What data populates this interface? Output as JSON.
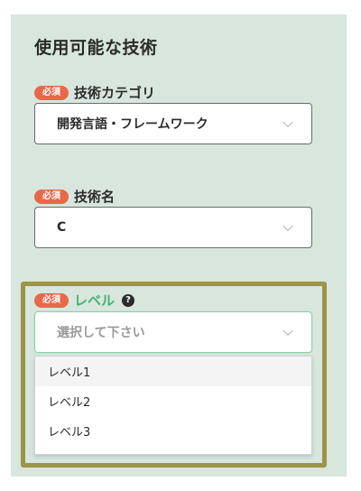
{
  "section": {
    "title": "使用可能な技術"
  },
  "required_badge": "必須",
  "category": {
    "label": "技術カテゴリ",
    "value": "開発言語・フレームワーク"
  },
  "tech_name": {
    "label": "技術名",
    "value": "C"
  },
  "level": {
    "label": "レベル",
    "help_icon": "?",
    "placeholder": "選択して下さい",
    "options": [
      "レベル1",
      "レベル2",
      "レベル3"
    ]
  },
  "colors": {
    "panel_bg": "#d8e6de",
    "badge": "#e8684a",
    "level_label": "#46b176",
    "highlight_frame": "#9c9447"
  }
}
